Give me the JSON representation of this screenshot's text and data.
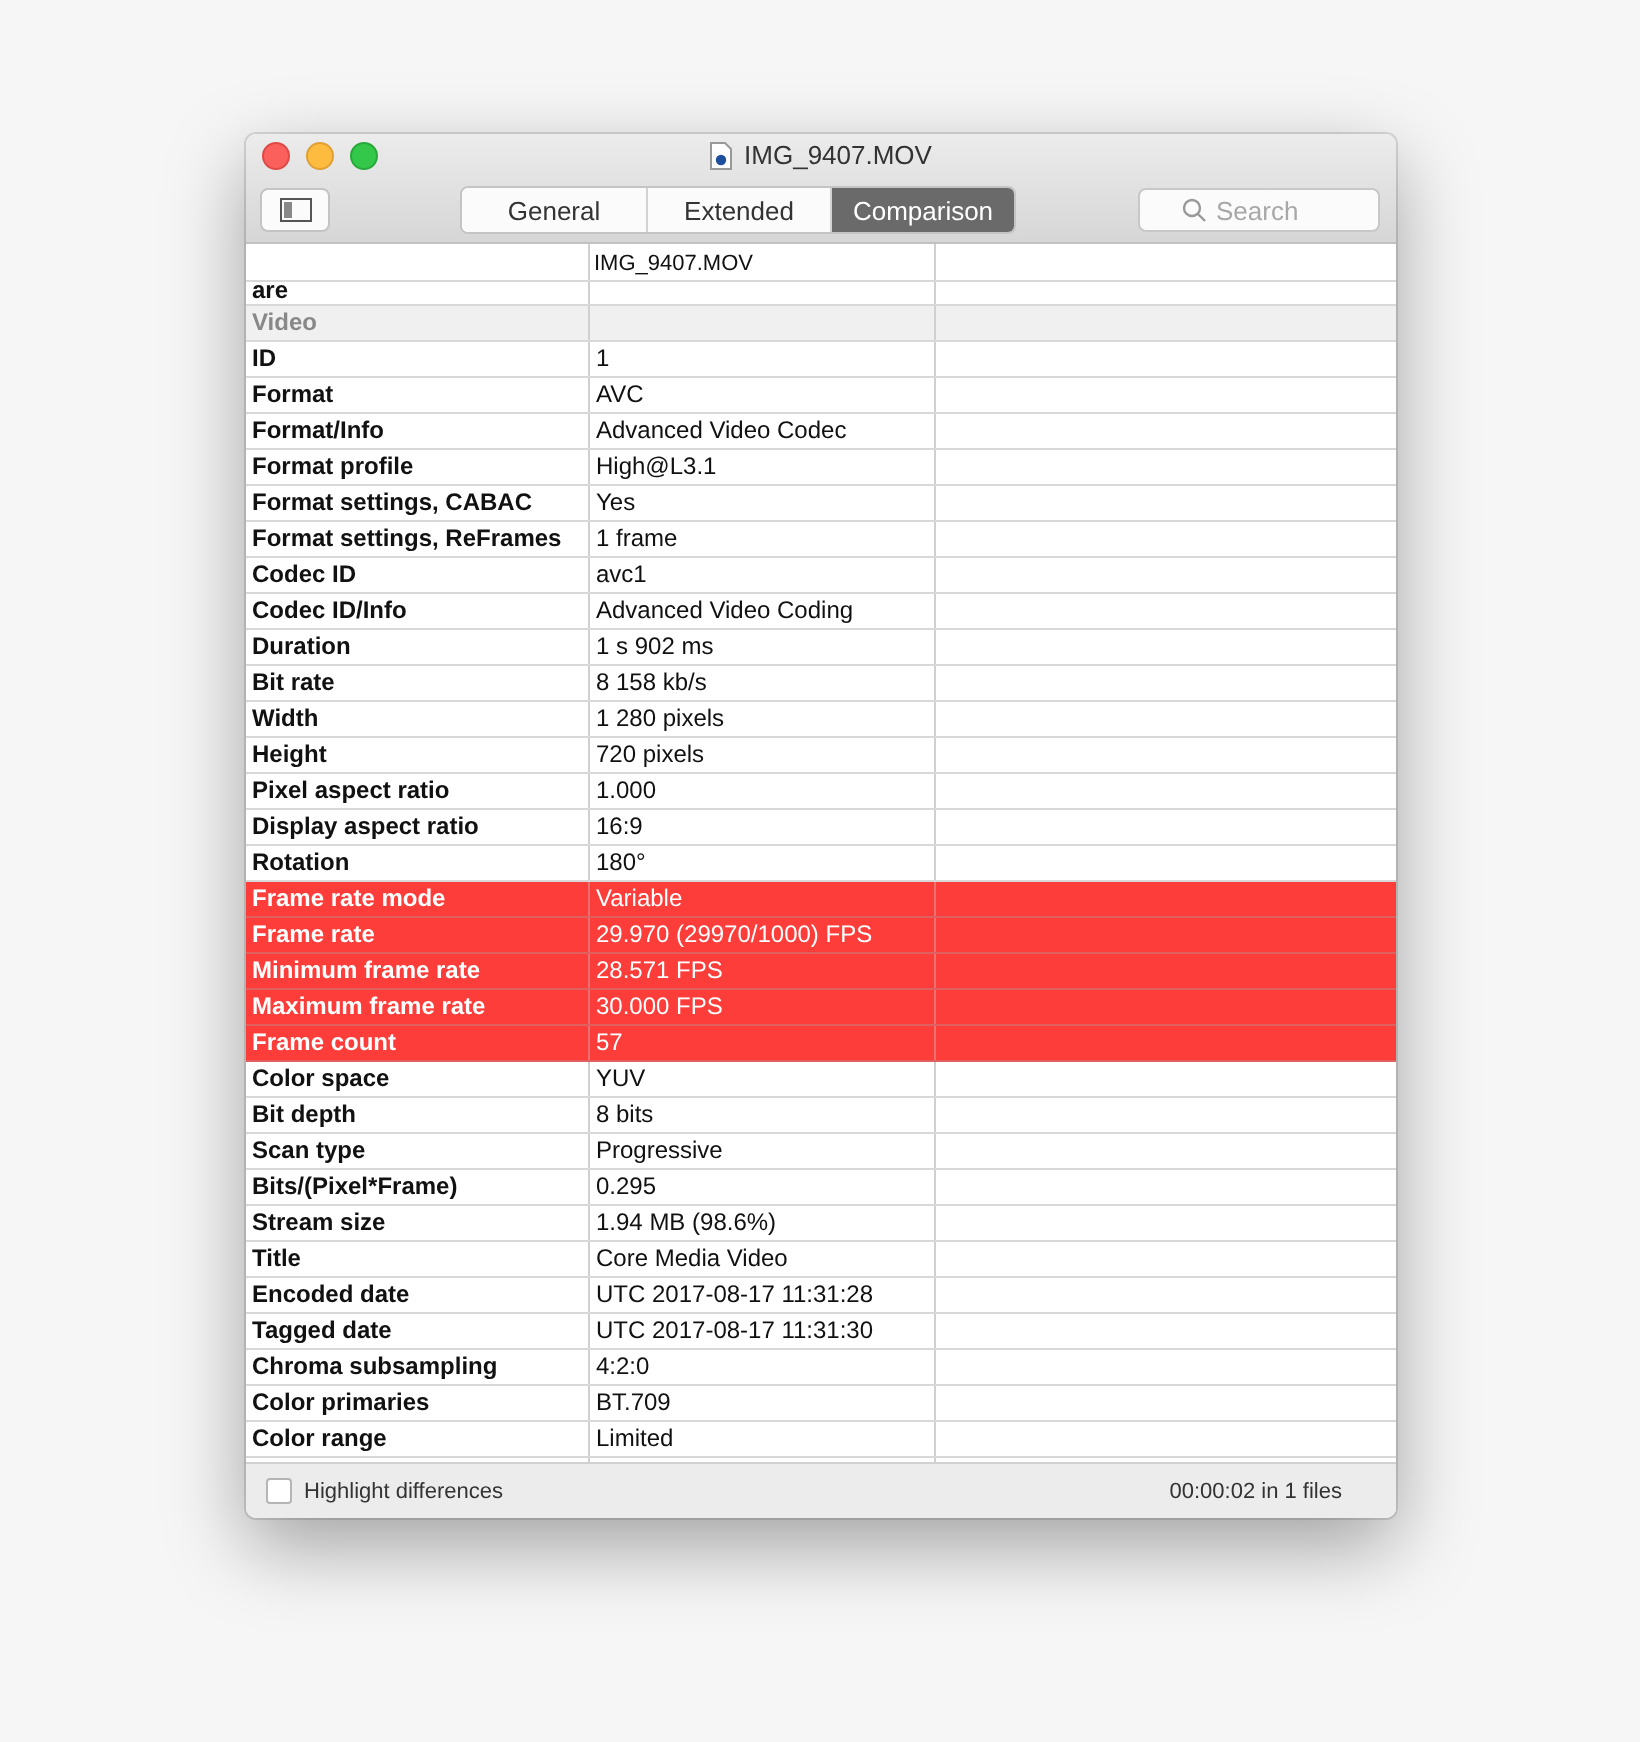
{
  "window": {
    "title": "IMG_9407.MOV"
  },
  "tabs": [
    {
      "label": "General",
      "selected": false
    },
    {
      "label": "Extended",
      "selected": false
    },
    {
      "label": "Comparison",
      "selected": true
    }
  ],
  "search": {
    "placeholder": "Search"
  },
  "table": {
    "columns": [
      "IMG_9407.MOV"
    ],
    "clipped_row": {
      "label": "are"
    },
    "rows": [
      {
        "kind": "section",
        "label": "Video",
        "value": "",
        "highlighted": false
      },
      {
        "kind": "field",
        "label": "ID",
        "value": "1",
        "highlighted": false
      },
      {
        "kind": "field",
        "label": "Format",
        "value": "AVC",
        "highlighted": false
      },
      {
        "kind": "field",
        "label": "Format/Info",
        "value": "Advanced Video Codec",
        "highlighted": false
      },
      {
        "kind": "field",
        "label": "Format profile",
        "value": "High@L3.1",
        "highlighted": false
      },
      {
        "kind": "field",
        "label": "Format settings, CABAC",
        "value": "Yes",
        "highlighted": false
      },
      {
        "kind": "field",
        "label": "Format settings, ReFrames",
        "value": "1 frame",
        "highlighted": false
      },
      {
        "kind": "field",
        "label": "Codec ID",
        "value": "avc1",
        "highlighted": false
      },
      {
        "kind": "field",
        "label": "Codec ID/Info",
        "value": "Advanced Video Coding",
        "highlighted": false
      },
      {
        "kind": "field",
        "label": "Duration",
        "value": "1 s 902 ms",
        "highlighted": false
      },
      {
        "kind": "field",
        "label": "Bit rate",
        "value": "8 158 kb/s",
        "highlighted": false
      },
      {
        "kind": "field",
        "label": "Width",
        "value": "1 280 pixels",
        "highlighted": false
      },
      {
        "kind": "field",
        "label": "Height",
        "value": "720 pixels",
        "highlighted": false
      },
      {
        "kind": "field",
        "label": "Pixel aspect ratio",
        "value": "1.000",
        "highlighted": false
      },
      {
        "kind": "field",
        "label": "Display aspect ratio",
        "value": "16:9",
        "highlighted": false
      },
      {
        "kind": "field",
        "label": "Rotation",
        "value": "180°",
        "highlighted": false
      },
      {
        "kind": "field",
        "label": "Frame rate mode",
        "value": "Variable",
        "highlighted": true
      },
      {
        "kind": "field",
        "label": "Frame rate",
        "value": "29.970 (29970/1000) FPS",
        "highlighted": true
      },
      {
        "kind": "field",
        "label": "Minimum frame rate",
        "value": "28.571 FPS",
        "highlighted": true
      },
      {
        "kind": "field",
        "label": "Maximum frame rate",
        "value": "30.000 FPS",
        "highlighted": true
      },
      {
        "kind": "field",
        "label": "Frame count",
        "value": "57",
        "highlighted": true
      },
      {
        "kind": "field",
        "label": "Color space",
        "value": "YUV",
        "highlighted": false
      },
      {
        "kind": "field",
        "label": "Bit depth",
        "value": "8 bits",
        "highlighted": false
      },
      {
        "kind": "field",
        "label": "Scan type",
        "value": "Progressive",
        "highlighted": false
      },
      {
        "kind": "field",
        "label": "Bits/(Pixel*Frame)",
        "value": "0.295",
        "highlighted": false
      },
      {
        "kind": "field",
        "label": "Stream size",
        "value": "1.94 MB (98.6%)",
        "highlighted": false
      },
      {
        "kind": "field",
        "label": "Title",
        "value": "Core Media Video",
        "highlighted": false
      },
      {
        "kind": "field",
        "label": "Encoded date",
        "value": "UTC 2017-08-17 11:31:28",
        "highlighted": false
      },
      {
        "kind": "field",
        "label": "Tagged date",
        "value": "UTC 2017-08-17 11:31:30",
        "highlighted": false
      },
      {
        "kind": "field",
        "label": "Chroma subsampling",
        "value": "4:2:0",
        "highlighted": false
      },
      {
        "kind": "field",
        "label": "Color primaries",
        "value": "BT.709",
        "highlighted": false
      },
      {
        "kind": "field",
        "label": "Color range",
        "value": "Limited",
        "highlighted": false
      }
    ]
  },
  "footer": {
    "checkbox": {
      "label": "Highlight differences",
      "checked": false
    },
    "status": "00:00:02 in 1 files"
  }
}
